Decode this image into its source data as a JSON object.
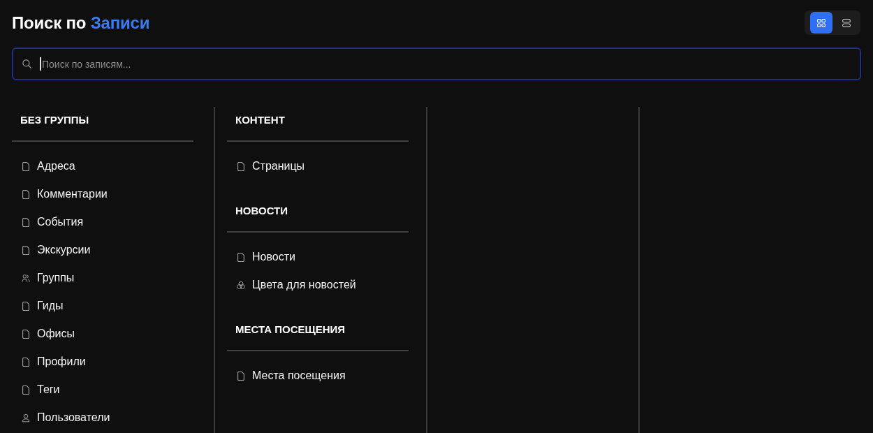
{
  "title": {
    "text": "Поиск по",
    "highlight": "Записи"
  },
  "view_modes": [
    {
      "kind": "grid",
      "selected": true
    },
    {
      "kind": "list",
      "selected": false
    }
  ],
  "search": {
    "placeholder": "Поиск по записям...",
    "focused": true
  },
  "columns": [
    {
      "groups": [
        {
          "heading": "БЕЗ ГРУППЫ",
          "items": [
            {
              "label": "Адреса",
              "kind": "document"
            },
            {
              "label": "Комментарии",
              "kind": "document"
            },
            {
              "label": "События",
              "kind": "document"
            },
            {
              "label": "Экскурсии",
              "kind": "document"
            },
            {
              "label": "Группы",
              "kind": "users"
            },
            {
              "label": "Гиды",
              "kind": "document"
            },
            {
              "label": "Офисы",
              "kind": "document"
            },
            {
              "label": "Профили",
              "kind": "document"
            },
            {
              "label": "Теги",
              "kind": "document"
            },
            {
              "label": "Пользователи",
              "kind": "user"
            }
          ]
        }
      ]
    },
    {
      "groups": [
        {
          "heading": "КОНТЕНТ",
          "items": [
            {
              "label": "Страницы",
              "kind": "document"
            }
          ]
        },
        {
          "heading": "НОВОСТИ",
          "items": [
            {
              "label": "Новости",
              "kind": "document"
            },
            {
              "label": "Цвета для новостей",
              "kind": "palette"
            }
          ]
        },
        {
          "heading": "МЕСТА ПОСЕЩЕНИЯ",
          "items": [
            {
              "label": "Места посещения",
              "kind": "document"
            }
          ]
        }
      ]
    }
  ]
}
